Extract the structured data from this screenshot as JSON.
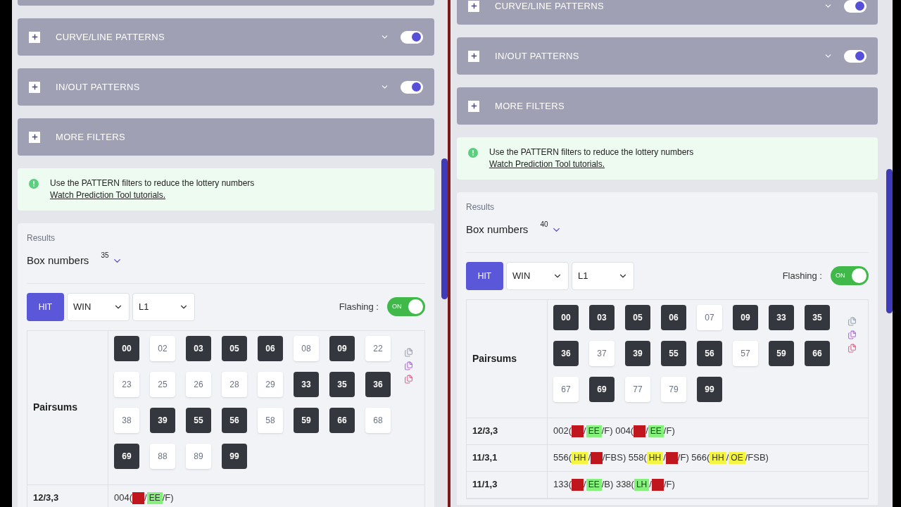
{
  "panels": [
    {
      "accordions": [
        {
          "kind": "cut"
        },
        {
          "kind": "toggle",
          "label": "CURVE/LINE PATTERNS",
          "on": true
        },
        {
          "kind": "toggle",
          "label": "IN/OUT PATTERNS",
          "on": true
        },
        {
          "kind": "plain",
          "label": "MORE FILTERS"
        }
      ],
      "alert": {
        "message": "Use the PATTERN filters to reduce the lottery numbers",
        "link": "Watch Prediction Tool tutorials."
      },
      "results": {
        "label": "Results",
        "title": "Box numbers",
        "count": "35"
      },
      "controls": {
        "hit": "HIT",
        "selects": [
          "WIN",
          "L1"
        ],
        "flashing_label": "Flashing :",
        "flashing": {
          "on": true,
          "label": "ON"
        }
      },
      "table": {
        "pairsums_label": "Pairsums",
        "numbers": [
          {
            "text": "00",
            "highlighted": true
          },
          {
            "text": "02",
            "highlighted": false
          },
          {
            "text": "03",
            "highlighted": true
          },
          {
            "text": "05",
            "highlighted": true
          },
          {
            "text": "06",
            "highlighted": true
          },
          {
            "text": "08",
            "highlighted": false
          },
          {
            "text": "09",
            "highlighted": true
          },
          {
            "text": "22",
            "highlighted": false
          },
          {
            "text": "23",
            "highlighted": false
          },
          {
            "text": "25",
            "highlighted": false
          },
          {
            "text": "26",
            "highlighted": false
          },
          {
            "text": "28",
            "highlighted": false
          },
          {
            "text": "29",
            "highlighted": false
          },
          {
            "text": "33",
            "highlighted": true
          },
          {
            "text": "35",
            "highlighted": true
          },
          {
            "text": "36",
            "highlighted": true
          },
          {
            "text": "38",
            "highlighted": false
          },
          {
            "text": "39",
            "highlighted": true
          },
          {
            "text": "55",
            "highlighted": true
          },
          {
            "text": "56",
            "highlighted": true
          },
          {
            "text": "58",
            "highlighted": false
          },
          {
            "text": "59",
            "highlighted": true
          },
          {
            "text": "66",
            "highlighted": true
          },
          {
            "text": "68",
            "highlighted": false
          },
          {
            "text": "69",
            "highlighted": true
          },
          {
            "text": "88",
            "highlighted": false
          },
          {
            "text": "89",
            "highlighted": false
          },
          {
            "text": "99",
            "highlighted": true
          }
        ],
        "rows": [
          {
            "label": "12/3,3",
            "parts": [
              {
                "text": "004("
              },
              {
                "color": "#c0161d"
              },
              {
                "text": "/"
              },
              {
                "tag": "EE",
                "color": "#86f07c"
              },
              {
                "text": "/F)"
              }
            ]
          }
        ]
      }
    },
    {
      "accordions": [
        {
          "kind": "toggle",
          "label": "CURVE/LINE PATTERNS",
          "on": true
        },
        {
          "kind": "toggle",
          "label": "IN/OUT PATTERNS",
          "on": true
        },
        {
          "kind": "plain",
          "label": "MORE FILTERS"
        }
      ],
      "alert": {
        "message": "Use the PATTERN filters to reduce the lottery numbers",
        "link": "Watch Prediction Tool tutorials."
      },
      "results": {
        "label": "Results",
        "title": "Box numbers",
        "count": "40"
      },
      "controls": {
        "hit": "HIT",
        "selects": [
          "WIN",
          "L1"
        ],
        "flashing_label": "Flashing :",
        "flashing": {
          "on": true,
          "label": "ON"
        }
      },
      "table": {
        "pairsums_label": "Pairsums",
        "numbers": [
          {
            "text": "00",
            "highlighted": true
          },
          {
            "text": "03",
            "highlighted": true
          },
          {
            "text": "05",
            "highlighted": true
          },
          {
            "text": "06",
            "highlighted": true
          },
          {
            "text": "07",
            "highlighted": false
          },
          {
            "text": "09",
            "highlighted": true
          },
          {
            "text": "33",
            "highlighted": true
          },
          {
            "text": "35",
            "highlighted": true
          },
          {
            "text": "36",
            "highlighted": true
          },
          {
            "text": "37",
            "highlighted": false
          },
          {
            "text": "39",
            "highlighted": true
          },
          {
            "text": "55",
            "highlighted": true
          },
          {
            "text": "56",
            "highlighted": true
          },
          {
            "text": "57",
            "highlighted": false
          },
          {
            "text": "59",
            "highlighted": true
          },
          {
            "text": "66",
            "highlighted": true
          },
          {
            "text": "67",
            "highlighted": false
          },
          {
            "text": "69",
            "highlighted": true
          },
          {
            "text": "77",
            "highlighted": false
          },
          {
            "text": "79",
            "highlighted": false
          },
          {
            "text": "99",
            "highlighted": true
          }
        ],
        "rows": [
          {
            "label": "12/3,3",
            "parts": [
              {
                "text": "002("
              },
              {
                "color": "#c0161d"
              },
              {
                "text": "/"
              },
              {
                "tag": "EE",
                "color": "#86f07c"
              },
              {
                "text": "/F) 004("
              },
              {
                "color": "#c0161d"
              },
              {
                "text": "/"
              },
              {
                "tag": "EE",
                "color": "#86f07c"
              },
              {
                "text": "/F)"
              }
            ]
          },
          {
            "label": "11/3,1",
            "parts": [
              {
                "text": "556("
              },
              {
                "tag": "HH",
                "color": "#f3f542"
              },
              {
                "text": "/"
              },
              {
                "color": "#c0161d"
              },
              {
                "text": "/FBS) 558("
              },
              {
                "tag": "HH",
                "color": "#f3f542"
              },
              {
                "text": "/"
              },
              {
                "color": "#c0161d"
              },
              {
                "text": "/F) 566("
              },
              {
                "tag": "HH",
                "color": "#f3f542"
              },
              {
                "text": "/"
              },
              {
                "tag": "OE",
                "color": "#f3f542"
              },
              {
                "text": "/FSB)"
              }
            ]
          },
          {
            "label": "11/1,3",
            "parts": [
              {
                "text": "133("
              },
              {
                "color": "#c0161d"
              },
              {
                "text": "/"
              },
              {
                "tag": "EE",
                "color": "#86f07c"
              },
              {
                "text": "/B) 338("
              },
              {
                "tag": "LH",
                "color": "#86f07c"
              },
              {
                "text": "/"
              },
              {
                "color": "#c0161d"
              },
              {
                "text": "/F)"
              }
            ]
          }
        ]
      }
    }
  ]
}
